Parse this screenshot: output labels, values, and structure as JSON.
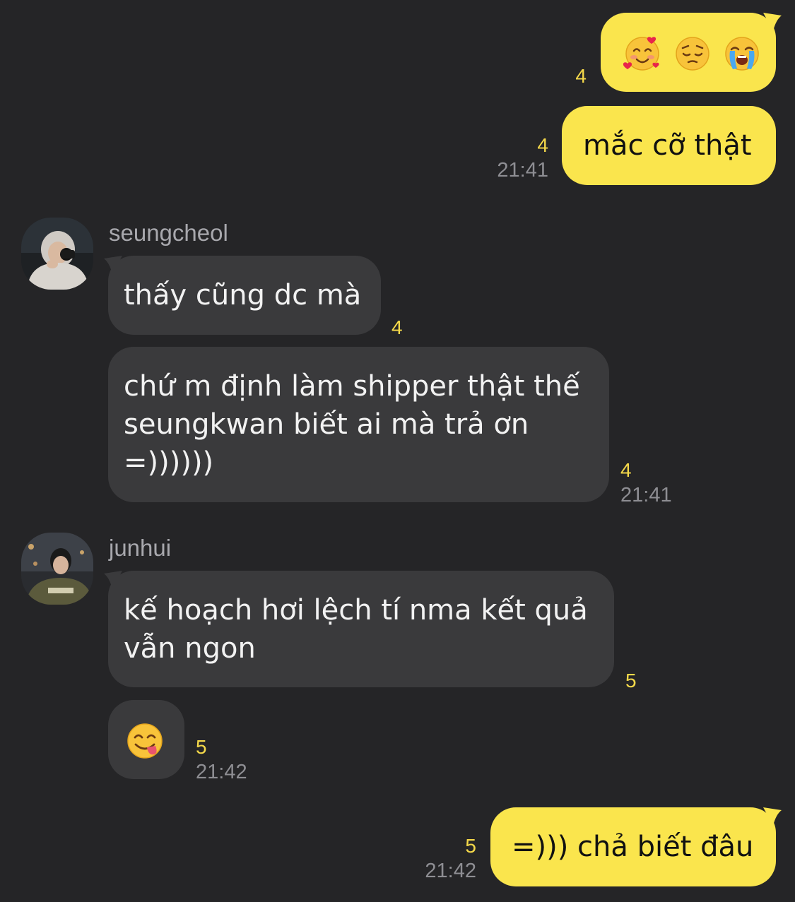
{
  "messages": {
    "m1": {
      "emojis": [
        "smiling-face-with-hearts",
        "pensive-face",
        "loudly-crying-face"
      ],
      "unread": "4"
    },
    "m2": {
      "text": "mắc cỡ thật",
      "unread": "4",
      "time": "21:41"
    },
    "seungcheol": {
      "name": "seungcheol"
    },
    "m3": {
      "text": "thấy cũng dc mà",
      "unread": "4"
    },
    "m4": {
      "line1": "chứ m định làm shipper thật thế",
      "line2": "seungkwan biết ai mà trả ơn",
      "line3": "=))))))",
      "unread": "4",
      "time": "21:41"
    },
    "junhui": {
      "name": "junhui"
    },
    "m5": {
      "line1": "kế hoạch hơi lệch tí nma kết quả",
      "line2": "vẫn ngon",
      "unread": "5"
    },
    "m6": {
      "emoji": "face-savoring-food",
      "unread": "5",
      "time": "21:42"
    },
    "m7": {
      "text": "=))) chả biết đâu",
      "unread": "5",
      "time": "21:42"
    }
  },
  "colors": {
    "background": "#252527",
    "my_bubble": "#fae54d",
    "their_bubble": "#3a3a3c",
    "unread_count": "#f5d94a",
    "timestamp": "#8e8e93"
  }
}
